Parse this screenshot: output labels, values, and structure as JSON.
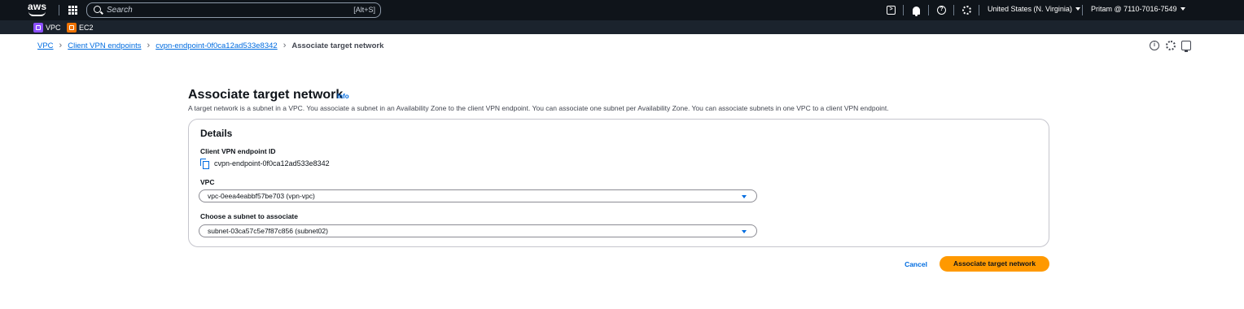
{
  "topnav": {
    "logo_text": "aws",
    "search_placeholder": "Search",
    "search_shortcut": "[Alt+S]",
    "region": "United States (N. Virginia)",
    "account": "Pritam @ 7110-7016-7549"
  },
  "services": [
    {
      "label": "VPC",
      "icon": "vpc-icon",
      "color": "#8c4fff"
    },
    {
      "label": "EC2",
      "icon": "ec2-icon",
      "color": "#ed7100"
    }
  ],
  "breadcrumb": {
    "items": [
      "VPC",
      "Client VPN endpoints",
      "cvpn-endpoint-0f0ca12ad533e8342"
    ],
    "current": "Associate target network"
  },
  "header": {
    "title": "Associate target network",
    "info": "Info",
    "description": "A target network is a subnet in a VPC. You associate a subnet in an Availability Zone to the client VPN endpoint. You can associate one subnet per Availability Zone. You can associate subnets in one VPC to a client VPN endpoint."
  },
  "details": {
    "title": "Details",
    "endpoint_label": "Client VPN endpoint ID",
    "endpoint_value": "cvpn-endpoint-0f0ca12ad533e8342",
    "vpc_label": "VPC",
    "vpc_value": "vpc-0eea4eabbf57be703 (vpn-vpc)",
    "subnet_label": "Choose a subnet to associate",
    "subnet_value": "subnet-03ca57c5e7f87c856 (subnet02)"
  },
  "actions": {
    "cancel": "Cancel",
    "submit": "Associate target network"
  },
  "colors": {
    "nav_bg": "#0f141a",
    "link": "#006ce0",
    "primary_button": "#ff9900"
  }
}
